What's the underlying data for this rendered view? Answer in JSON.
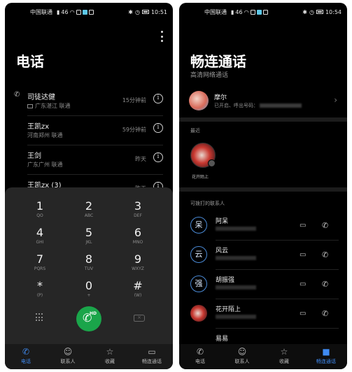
{
  "left": {
    "statusbar": {
      "carrier": "中国联通",
      "signal": "46",
      "time": "10:51"
    },
    "title": "电话",
    "recents": [
      {
        "name": "司徒达健",
        "location": "广东湛江 联通",
        "time": "15分钟前",
        "sim": true
      },
      {
        "name": "王凯zx",
        "location": "河南郑州 联通",
        "time": "59分钟前"
      },
      {
        "name": "王剑",
        "location": "广东广州 联通",
        "time": "昨天"
      },
      {
        "name": "王凯zx (3)",
        "location": "",
        "time": "昨天"
      }
    ],
    "keys": [
      {
        "num": "1",
        "letters": "QO"
      },
      {
        "num": "2",
        "letters": "ABC"
      },
      {
        "num": "3",
        "letters": "DEF"
      },
      {
        "num": "4",
        "letters": "GHI"
      },
      {
        "num": "5",
        "letters": "JKL"
      },
      {
        "num": "6",
        "letters": "MNO"
      },
      {
        "num": "7",
        "letters": "PQRS"
      },
      {
        "num": "8",
        "letters": "TUV"
      },
      {
        "num": "9",
        "letters": "WXYZ"
      },
      {
        "num": "*",
        "letters": "(P)"
      },
      {
        "num": "0",
        "letters": "+"
      },
      {
        "num": "#",
        "letters": "(W)"
      }
    ],
    "call_button_badge": "HD",
    "nav": [
      {
        "label": "电话",
        "icon": "phone-icon"
      },
      {
        "label": "联系人",
        "icon": "contacts-icon"
      },
      {
        "label": "收藏",
        "icon": "star-icon"
      },
      {
        "label": "畅连通话",
        "icon": "video-call-icon"
      }
    ],
    "accent": "#3f8bf2",
    "call_color": "#1aa54a"
  },
  "right": {
    "statusbar": {
      "carrier": "中国联通",
      "signal": "46",
      "time": "10:54"
    },
    "title": "畅连通话",
    "subtitle": "高清网络通话",
    "profile": {
      "name": "摩尔",
      "status": "已开启、呼出号码："
    },
    "recent_label": "最近",
    "recent_contact": "花开陌上",
    "contacts_label": "可拨打的联系人",
    "contacts": [
      {
        "initial": "呆",
        "name": "阿呆"
      },
      {
        "initial": "云",
        "name": "风云"
      },
      {
        "initial": "强",
        "name": "胡振强"
      },
      {
        "initial": "",
        "name": "花开陌上",
        "photo": true
      },
      {
        "initial": "",
        "name": "易易"
      }
    ],
    "nav": [
      {
        "label": "电话",
        "icon": "phone-icon"
      },
      {
        "label": "联系人",
        "icon": "contacts-icon"
      },
      {
        "label": "收藏",
        "icon": "star-icon"
      },
      {
        "label": "畅连通话",
        "icon": "video-call-icon"
      }
    ]
  }
}
